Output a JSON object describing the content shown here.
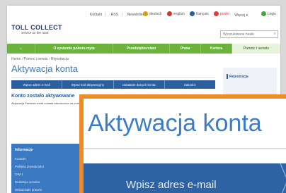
{
  "topbar": {
    "links": [
      "Kontakt",
      "RSS",
      "Newsletter"
    ],
    "languages": [
      {
        "label": "deutsch",
        "color": "#d4a017"
      },
      {
        "label": "english",
        "color": "#c0392b"
      },
      {
        "label": "français",
        "color": "#2a5aa0"
      },
      {
        "label": "polski",
        "color": "#d93c3c"
      }
    ],
    "more": "Więcej ▾",
    "login": "Login"
  },
  "logo": {
    "name": "TOLL COLLECT",
    "tagline": "service on the road"
  },
  "search": {
    "placeholder": "Wyszukiwane hasło"
  },
  "nav": {
    "home_icon": "home-icon",
    "items": [
      "O systemie poboru myta",
      "Przedsiębiorstwo",
      "Prasa",
      "Kariera",
      "Pomoc i serwis"
    ],
    "active_index": 4
  },
  "breadcrumb": "Home  ›  Pomoc i serwis  ›  Rejestracja",
  "page_title": "Aktywacja konta",
  "steps": [
    "Wpisz adres e-mail",
    "Wpisz kod aktywacyjny",
    "Ustalanie danych konta",
    "Zakończ"
  ],
  "sidebox": {
    "link": "Rejestracja"
  },
  "confirm": {
    "heading": "Konto zostało aktywowane",
    "text": "Aktywacja Państwa konta została zakończona na portalu."
  },
  "sidenav": {
    "heading": "Informacje",
    "items": [
      "Kontakt",
      "Polityka prywatności",
      "OWU",
      "Redakcja serwisu",
      "Wskazówki prawne"
    ]
  },
  "zoom": {
    "title": "Aktywacja konta",
    "step_label": "Wpisz adres e-mail"
  },
  "colors": {
    "green": "#6cb33e",
    "blue": "#2b5f9f",
    "orange": "#ef8a24"
  }
}
